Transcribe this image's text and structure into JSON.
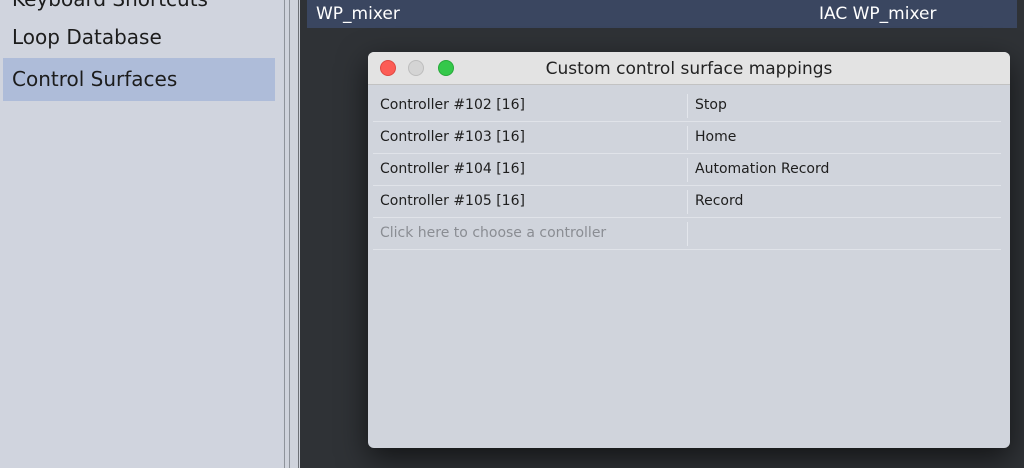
{
  "sidebar": {
    "items": [
      {
        "label": "Keyboard Shortcuts",
        "selected": false
      },
      {
        "label": "Loop Database",
        "selected": false
      },
      {
        "label": "Control Surfaces",
        "selected": true
      }
    ]
  },
  "device": {
    "name": "WP_mixer",
    "port": "IAC WP_mixer"
  },
  "dialog": {
    "title": "Custom control surface mappings",
    "rows": [
      {
        "controller": "Controller #102 [16]",
        "action": "Stop"
      },
      {
        "controller": "Controller #103 [16]",
        "action": "Home"
      },
      {
        "controller": "Controller #104 [16]",
        "action": "Automation Record"
      },
      {
        "controller": "Controller #105 [16]",
        "action": "Record"
      }
    ],
    "placeholder": "Click here to choose a controller"
  },
  "colors": {
    "sidebar_bg": "#d0d4de",
    "selection": "#aebcd9",
    "device_row": "#3a4660",
    "close": "#fc5c55",
    "maximize": "#34c84a"
  }
}
